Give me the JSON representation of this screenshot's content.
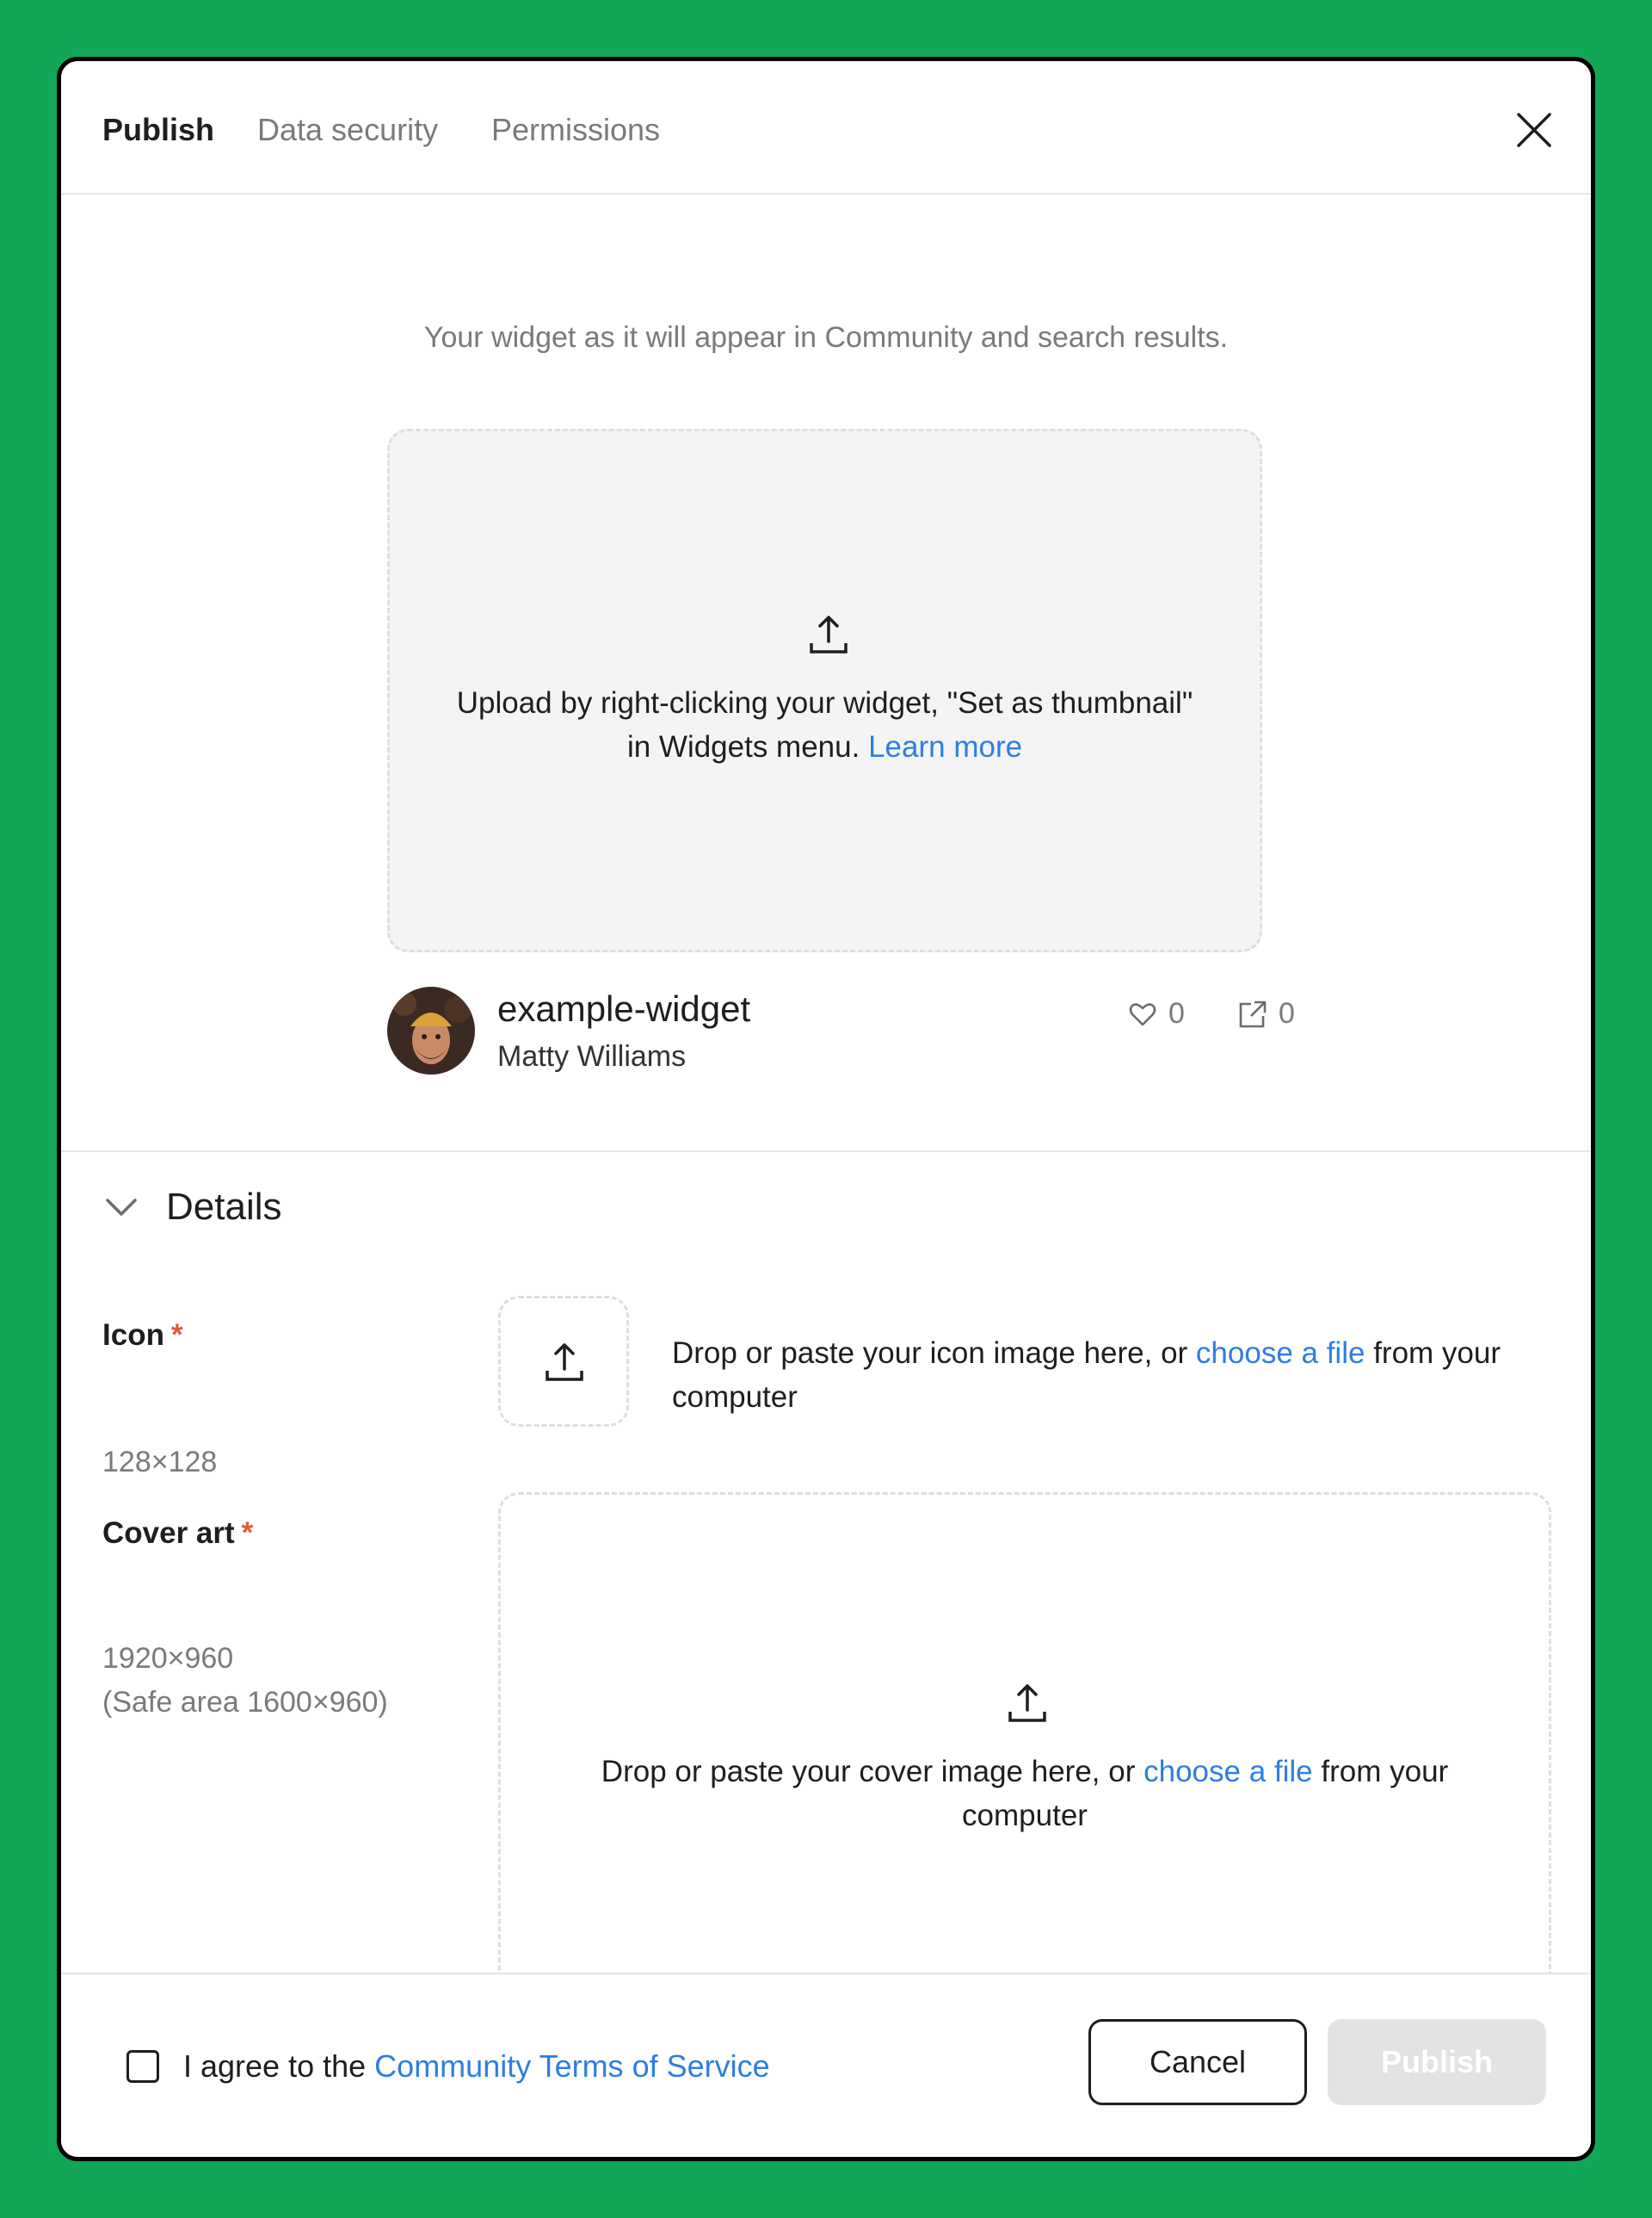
{
  "tabs": [
    {
      "label": "Publish",
      "active": true
    },
    {
      "label": "Data security",
      "active": false
    },
    {
      "label": "Permissions",
      "active": false
    }
  ],
  "preview": {
    "caption": "Your widget as it will appear in Community and search results.",
    "thumbnail_text": "Upload by right-clicking your widget, \"Set as thumbnail\" in Widgets menu.",
    "learn_more": "Learn more",
    "widget_name": "example-widget",
    "author": "Matty Williams",
    "likes": "0",
    "uses": "0"
  },
  "details": {
    "title": "Details",
    "icon": {
      "label": "Icon",
      "required_mark": "*",
      "size": "128×128",
      "drop_prefix": "Drop or paste your icon image here, or",
      "drop_link": "choose a file",
      "drop_suffix": "from your computer"
    },
    "cover": {
      "label": "Cover art",
      "required_mark": "*",
      "size": "1920×960",
      "safe_area": "(Safe area 1600×960)",
      "drop_prefix": "Drop or paste your cover image here, or",
      "drop_link": "choose a file",
      "drop_suffix": "from your computer"
    }
  },
  "footer": {
    "agree_prefix": "I agree to the",
    "terms_link": "Community Terms of Service",
    "cancel_label": "Cancel",
    "publish_label": "Publish"
  },
  "colors": {
    "background": "#12a756",
    "link": "#2f7de1",
    "required": "#e05a3c",
    "publish_disabled": "#e3e3e3"
  },
  "icons": [
    "close-icon",
    "upload-icon",
    "heart-icon",
    "share-icon",
    "chevron-down-icon"
  ]
}
